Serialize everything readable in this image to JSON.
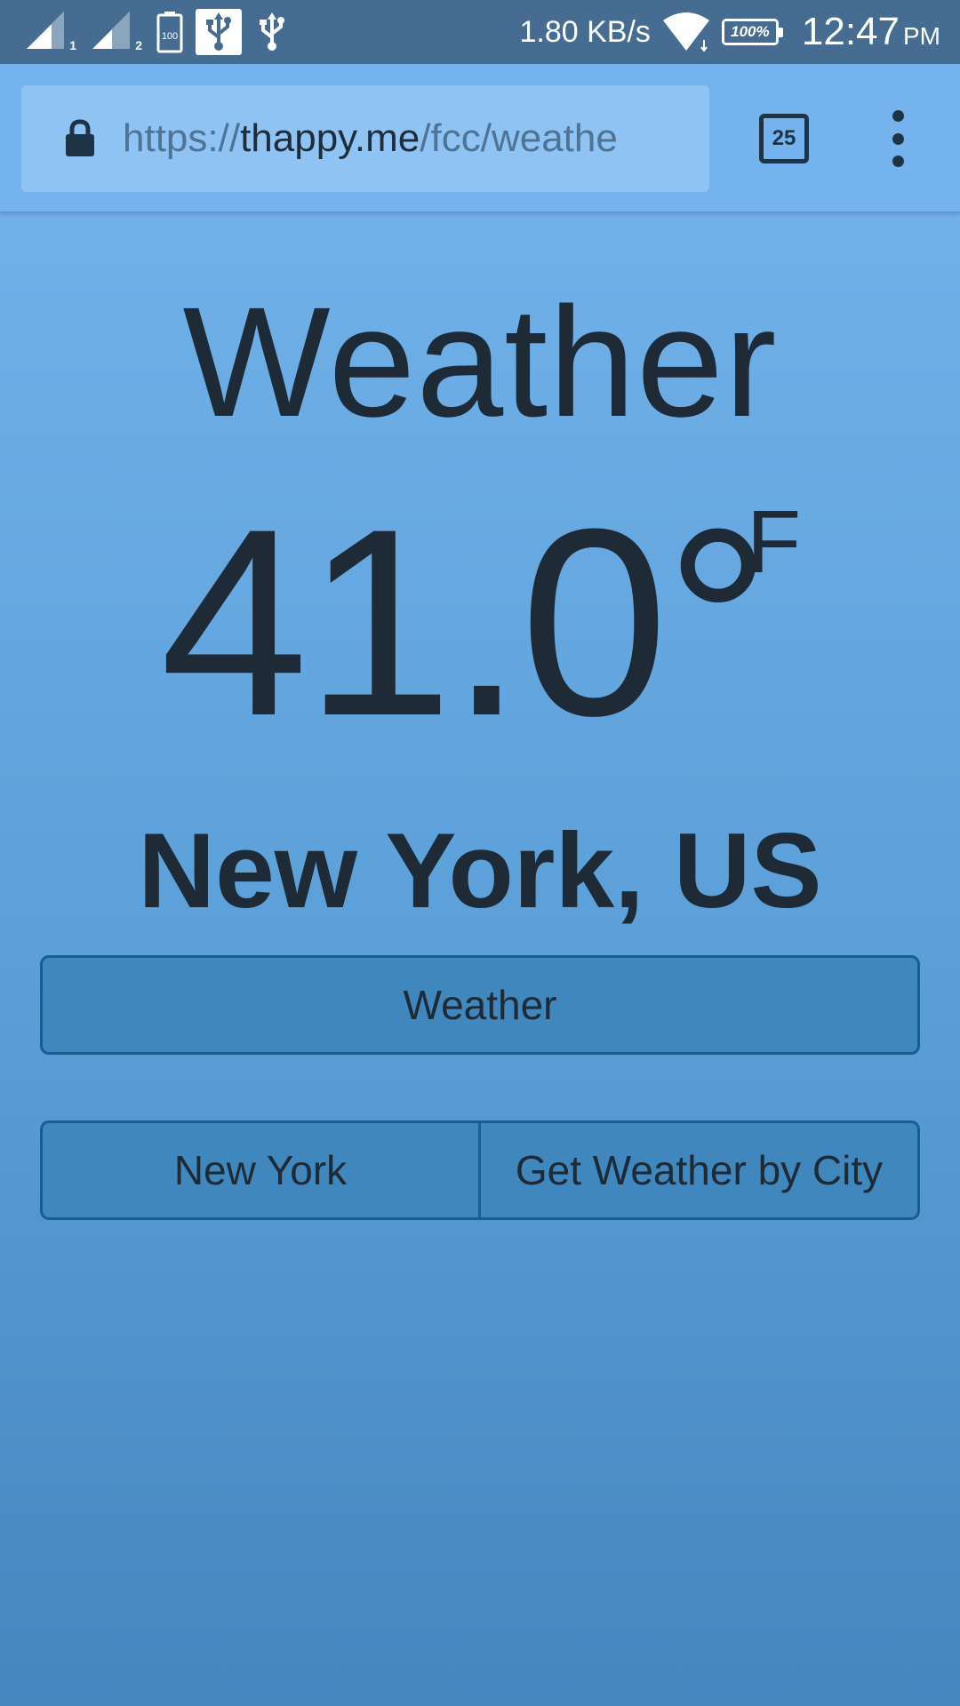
{
  "status_bar": {
    "sim1_label": "1",
    "sim2_label": "2",
    "battery_small_label": "100",
    "net_speed": "1.80 KB/s",
    "battery_percent": "100%",
    "time": "12:47",
    "ampm": "PM"
  },
  "browser": {
    "url_scheme": "https://",
    "url_host": "thappy.me",
    "url_path": "/fcc/weathe",
    "tab_count": "25"
  },
  "page": {
    "title": "Weather",
    "temperature": "41.0°",
    "unit": "F",
    "city": "New York, US",
    "weather_button": "Weather",
    "city_value": "New York",
    "get_by_city_button": "Get Weather by City"
  },
  "colors": {
    "status_bar_bg": "#466d91",
    "toolbar_bg": "#74b3ee",
    "button_bg": "#3f87bd",
    "button_border": "#175f91",
    "text_dark": "#1e2a35"
  }
}
